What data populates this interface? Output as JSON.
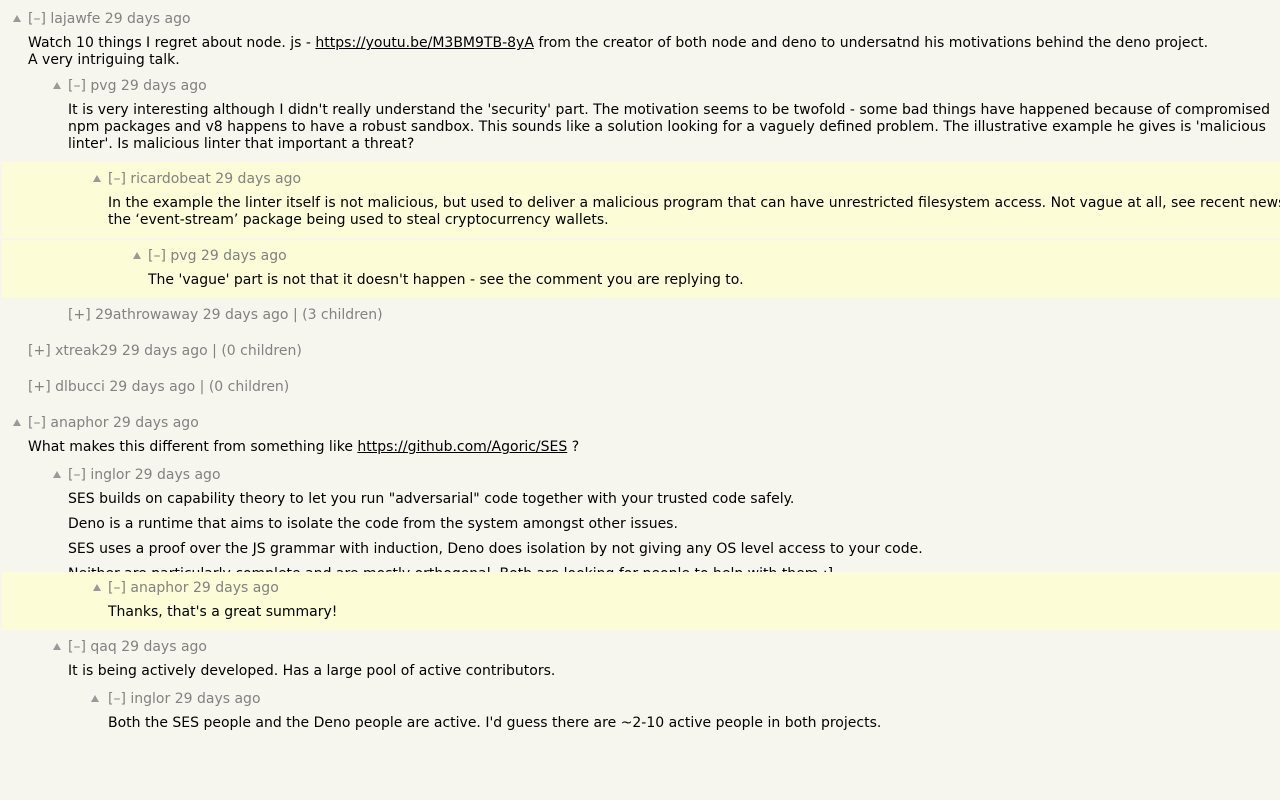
{
  "comments": [
    {
      "toggle": "[–]",
      "user": "lajawfe",
      "age": "29 days ago",
      "text": {
        "l1_pre": "Watch 10 things I regret about node. js - ",
        "l1_link": "https://youtu.be/M3BM9TB-8yA",
        "l1_post": " from the creator of both node and deno to undersatnd his motivations behind the deno project.",
        "l2": "A very intriguing talk."
      }
    },
    {
      "toggle": "[–]",
      "user": "pvg",
      "age": "29 days ago",
      "text": {
        "l1": "It is very interesting although I didn't really understand the 'security' part. The motivation seems to be twofold - some bad things have happened because of compromised",
        "l2": "npm packages and v8 happens to have a robust sandbox. This sounds like a solution looking for a vaguely defined problem. The illustrative example he gives is 'malicious",
        "l3": "linter'. Is malicious linter that important a threat?"
      }
    },
    {
      "toggle": "[–]",
      "user": "ricardobeat",
      "age": "29 days ago",
      "text": {
        "l1": "In the example the linter itself is not malicious, but used to deliver a malicious program that can have unrestricted filesystem access. Not vague at all, see recent news",
        "l2": "the ‘event-stream’ package being used to steal cryptocurrency wallets."
      }
    },
    {
      "toggle": "[–]",
      "user": "pvg",
      "age": "29 days ago",
      "text": {
        "l1": "The 'vague' part is not that it doesn't happen - see the comment you are replying to."
      }
    },
    {
      "toggle": "[+]",
      "user": "29athrowaway",
      "age": "29 days ago",
      "sep": "|",
      "kids": "(3 children)"
    },
    {
      "toggle": "[+]",
      "user": "xtreak29",
      "age": "29 days ago",
      "sep": "|",
      "kids": "(0 children)"
    },
    {
      "toggle": "[+]",
      "user": "dlbucci",
      "age": "29 days ago",
      "sep": "|",
      "kids": "(0 children)"
    },
    {
      "toggle": "[–]",
      "user": "anaphor",
      "age": "29 days ago",
      "text": {
        "l1_pre": "What makes this different from something like ",
        "l1_link": "https://github.com/Agoric/SES",
        "l1_post": " ?"
      }
    },
    {
      "toggle": "[–]",
      "user": "inglor",
      "age": "29 days ago",
      "text": {
        "p1": "SES builds on capability theory to let you run \"adversarial\" code together with your trusted code safely.",
        "p2": "Deno is a runtime that aims to isolate the code from the system amongst other issues.",
        "p3": "SES uses a proof over the JS grammar with induction, Deno does isolation by not giving any OS level access to your code.",
        "p4": "Neither are particularly complete and are mostly orthogonal. Both are looking for people to help with them :]"
      }
    },
    {
      "toggle": "[–]",
      "user": "anaphor",
      "age": "29 days ago",
      "text": {
        "l1": "Thanks, that's a great summary!"
      }
    },
    {
      "toggle": "[–]",
      "user": "qaq",
      "age": "29 days ago",
      "text": {
        "l1": "It is being actively developed. Has a large pool of active contributors."
      }
    },
    {
      "toggle": "[–]",
      "user": "inglor",
      "age": "29 days ago",
      "text": {
        "l1": "Both the SES people and the Deno people are active. I'd guess there are ~2-10 active people in both projects."
      }
    }
  ]
}
